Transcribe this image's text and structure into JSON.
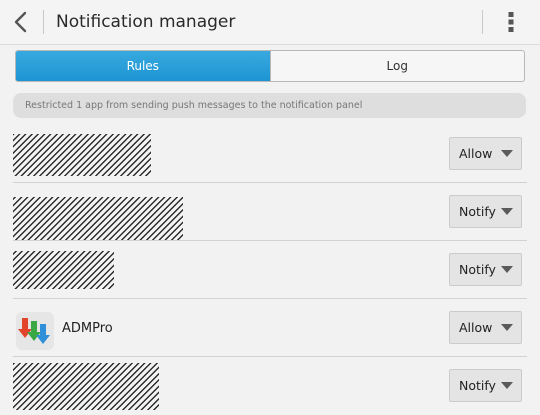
{
  "header": {
    "title": "Notification manager",
    "back_icon": "chevron-left-icon",
    "menu_icon": "more-vertical-icon"
  },
  "tabs": [
    {
      "label": "Rules",
      "active": true
    },
    {
      "label": "Log",
      "active": false
    }
  ],
  "banner": {
    "text": "Restricted 1 app from sending push messages to the notification panel"
  },
  "apps": [
    {
      "name": "",
      "redacted": true,
      "setting": "Allow"
    },
    {
      "name": "",
      "redacted": true,
      "setting": "Notify"
    },
    {
      "name": "",
      "redacted": true,
      "setting": "Notify"
    },
    {
      "name": "ADMPro",
      "redacted": false,
      "setting": "Allow"
    },
    {
      "name": "",
      "redacted": true,
      "setting": "Notify"
    }
  ],
  "colors": {
    "accent": "#1d95d3",
    "background": "#f2f2f2"
  }
}
